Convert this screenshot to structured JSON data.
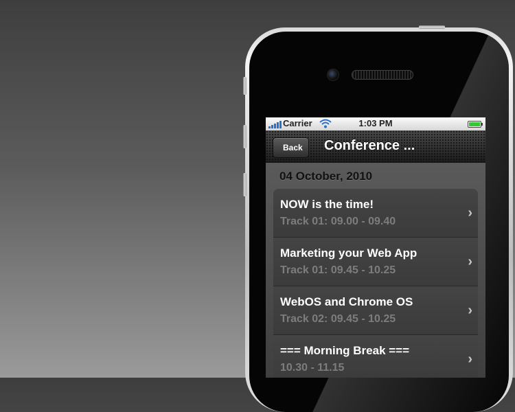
{
  "status_bar": {
    "carrier": "Carrier",
    "time": "1:03 PM"
  },
  "nav_bar": {
    "back_label": "Back",
    "title": "Conference ..."
  },
  "section": {
    "date": "04 October, 2010"
  },
  "sessions": [
    {
      "title": "NOW is the time!",
      "subtitle": "Track 01: 09.00 - 09.40"
    },
    {
      "title": "Marketing your Web App",
      "subtitle": "Track 01: 09.45 - 10.25"
    },
    {
      "title": "WebOS and Chrome OS",
      "subtitle": "Track 02: 09.45 - 10.25"
    },
    {
      "title": "=== Morning Break ===",
      "subtitle": "10.30 - 11.15"
    }
  ],
  "colors": {
    "accent": "#2a6fc9",
    "battery": "#37c635"
  }
}
